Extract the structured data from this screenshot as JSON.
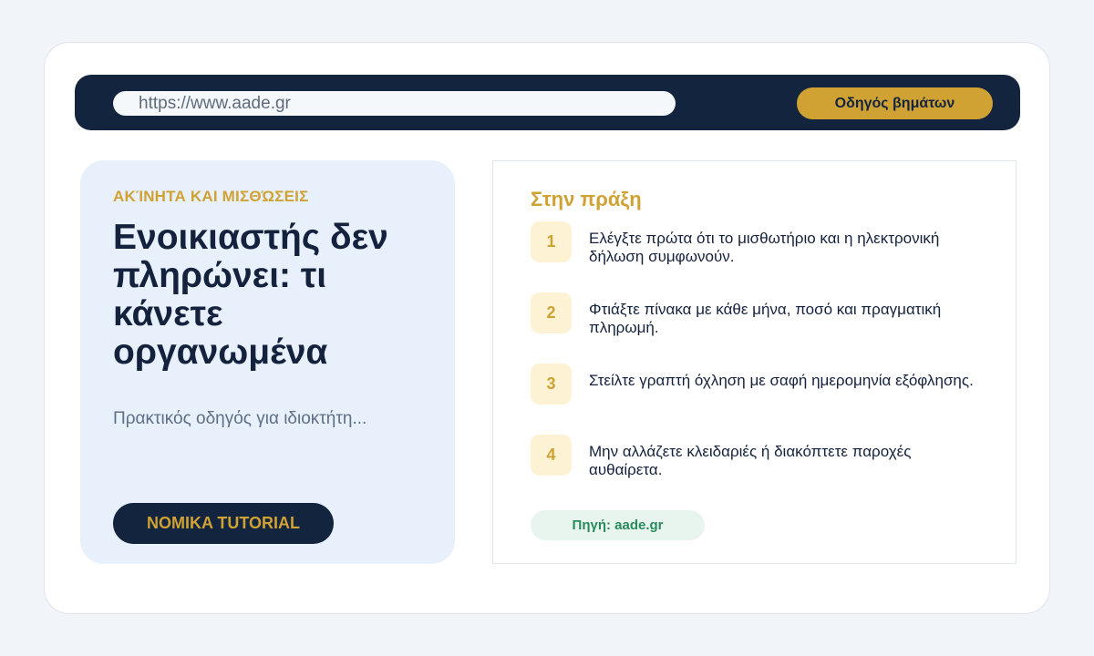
{
  "browser": {
    "url": "https://www.aade.gr",
    "guide_button_label": "Οδηγός βημάτων"
  },
  "article": {
    "category": "ΑΚΊΝΗΤΑ ΚΑΙ ΜΙΣΘΏΣΕΙΣ",
    "title": "Ενοικιαστής δεν πληρώνει: τι κάνετε οργανωμένα",
    "subtitle": "Πρακτικός οδηγός για ιδιοκτήτη...",
    "brand_button_label": "NOMIKA TUTORIAL"
  },
  "practice": {
    "title": "Στην πράξη",
    "steps": [
      {
        "number": "1",
        "text": "Ελέγξτε πρώτα ότι το μισθωτήριο και η ηλεκτρονική δήλωση συμφωνούν."
      },
      {
        "number": "2",
        "text": "Φτιάξτε πίνακα με κάθε μήνα, ποσό και πραγματική πληρωμή."
      },
      {
        "number": "3",
        "text": "Στείλτε γραπτή όχληση με σαφή ημερομηνία εξόφλησης."
      },
      {
        "number": "4",
        "text": "Μην αλλάζετε κλειδαριές ή διακόπτετε παροχές αυθαίρετα."
      }
    ],
    "source_label": "Πηγή: aade.gr"
  },
  "colors": {
    "navy": "#13243f",
    "gold": "#cfa233",
    "panel_blue": "#e7f0fb",
    "source_green": "#2a8a5d"
  }
}
